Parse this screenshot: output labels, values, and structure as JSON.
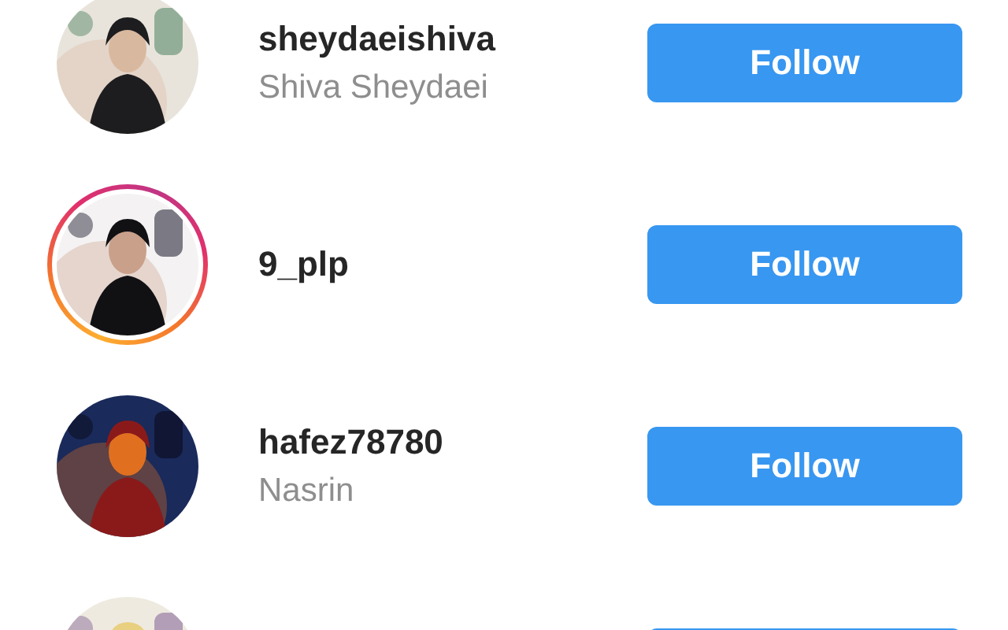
{
  "users": [
    {
      "username": "sheydaeishiva",
      "full_name": "Shiva Sheydaei",
      "story": false,
      "button": "Follow"
    },
    {
      "username": "9_plp",
      "story": true,
      "button": "Follow"
    },
    {
      "username": "hafez78780",
      "full_name": "Nasrin",
      "story": false,
      "button": "Follow"
    },
    {
      "story": false
    }
  ]
}
